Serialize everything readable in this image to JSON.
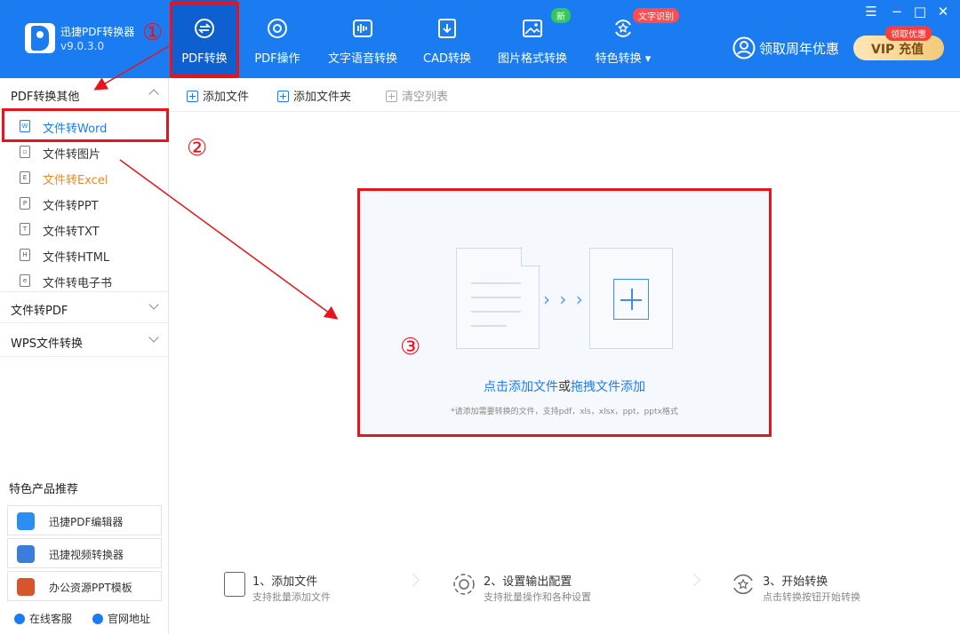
{
  "app": {
    "name": "迅捷PDF转换器",
    "version": "v9.0.3.0"
  },
  "nav": [
    {
      "label": "PDF转换",
      "icon": "convert-icon",
      "active": true
    },
    {
      "label": "PDF操作",
      "icon": "settings-circle-icon"
    },
    {
      "label": "文字语音转换",
      "icon": "waveform-icon"
    },
    {
      "label": "CAD转换",
      "icon": "cad-icon"
    },
    {
      "label": "图片格式转换",
      "icon": "image-icon",
      "badge": "新"
    },
    {
      "label": "特色转换 ▾",
      "icon": "star-convert-icon",
      "badge": "文字识别"
    }
  ],
  "window": {
    "menu": "☰",
    "minimize": "−",
    "maximize": "□",
    "close": "✕"
  },
  "promo": {
    "label": "领取周年优惠",
    "vip_label": "VIP 充值",
    "vip_badge": "领取优惠"
  },
  "sidebar": {
    "sections": [
      {
        "title": "PDF转换其他",
        "expanded": true
      },
      {
        "title": "文件转PDF",
        "expanded": false
      },
      {
        "title": "WPS文件转换",
        "expanded": false
      }
    ],
    "items": [
      {
        "label": "文件转Word",
        "icon_letter": "W",
        "selected": true
      },
      {
        "label": "文件转图片",
        "icon_letter": "▫"
      },
      {
        "label": "文件转Excel",
        "icon_letter": "E",
        "highlight": "orange"
      },
      {
        "label": "文件转PPT",
        "icon_letter": "P"
      },
      {
        "label": "文件转TXT",
        "icon_letter": "T"
      },
      {
        "label": "文件转HTML",
        "icon_letter": "H"
      },
      {
        "label": "文件转电子书",
        "icon_letter": "e"
      }
    ],
    "recommend_title": "特色产品推荐",
    "recommend": [
      {
        "label": "迅捷PDF编辑器",
        "color": "#2b8ef0"
      },
      {
        "label": "迅捷视频转换器",
        "color": "#3b7ddd"
      },
      {
        "label": "办公资源PPT模板",
        "color": "#d9532c"
      }
    ],
    "bottom": {
      "service": "在线客服",
      "website": "官网地址"
    }
  },
  "toolbar": {
    "add_file": "添加文件",
    "add_folder": "添加文件夹",
    "clear_list": "清空列表"
  },
  "dropzone": {
    "link1": "点击添加文件",
    "or": "或",
    "link2": "拖拽文件添加",
    "hint": "*请添加需要转换的文件，支持pdf，xls，xlsx，ppt，pptx格式",
    "arrows": "› › ›"
  },
  "steps": [
    {
      "title": "1、添加文件",
      "desc": "支持批量添加文件"
    },
    {
      "title": "2、设置输出配置",
      "desc": "支持批量操作和各种设置"
    },
    {
      "title": "3、开始转换",
      "desc": "点击转换按钮开始转换"
    }
  ],
  "annotations": {
    "n1": "①",
    "n2": "②",
    "n3": "③"
  },
  "colors": {
    "primary": "#1a7cf0",
    "annotation": "#e8141c",
    "accent_orange": "#e88b25"
  }
}
